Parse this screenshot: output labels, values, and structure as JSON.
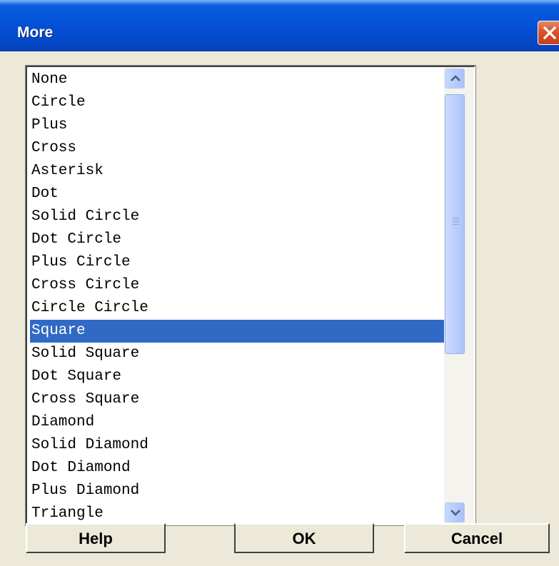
{
  "window": {
    "title": "More",
    "close_icon": "close-icon",
    "titlebar_color": "#0453d8",
    "close_color": "#d9522a"
  },
  "list": {
    "items": [
      "None",
      "Circle",
      "Plus",
      "Cross",
      "Asterisk",
      "Dot",
      "Solid Circle",
      "Dot Circle",
      "Plus Circle",
      "Cross Circle",
      "Circle Circle",
      "Square",
      "Solid Square",
      "Dot Square",
      "Cross Square",
      "Diamond",
      "Solid Diamond",
      "Dot Diamond",
      "Plus Diamond",
      "Triangle"
    ],
    "selected": "Square",
    "selection_color": "#316ac5",
    "scrollbar": {
      "up_icon": "scroll-up-arrow-icon",
      "down_icon": "scroll-down-arrow-icon",
      "thumb_icon": "scroll-thumb-grip-icon"
    }
  },
  "buttons": {
    "help_label": "Help",
    "ok_label": "OK",
    "cancel_label": "Cancel"
  }
}
